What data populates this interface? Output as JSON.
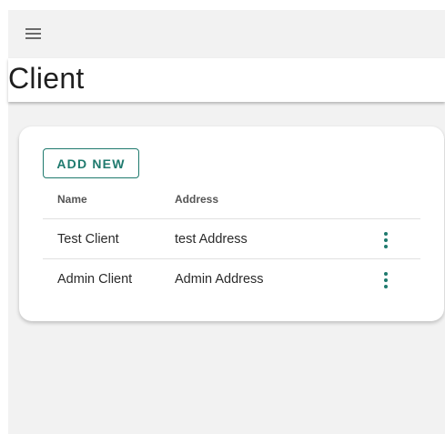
{
  "colors": {
    "accent": "#1f7a6e",
    "background": "#f2f2f2",
    "surface": "#ffffff"
  },
  "header": {
    "menu_icon": "hamburger-menu-icon"
  },
  "page": {
    "title": "Client"
  },
  "toolbar": {
    "add_label": "ADD NEW"
  },
  "table": {
    "columns": [
      "Name",
      "Address",
      ""
    ],
    "rows": [
      {
        "name": "Test Client",
        "address": "test Address",
        "action_icon": "more-vertical-icon"
      },
      {
        "name": "Admin Client",
        "address": "Admin Address",
        "action_icon": "more-vertical-icon"
      }
    ]
  }
}
